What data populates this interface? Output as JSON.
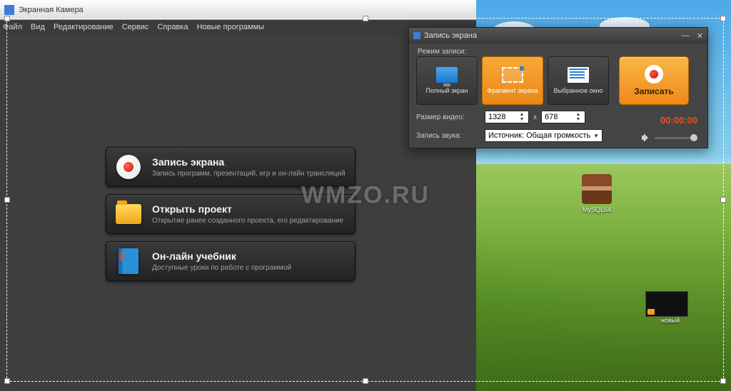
{
  "app": {
    "title": "Экранная Камера",
    "menu": [
      "Файл",
      "Вид",
      "Редактирование",
      "Сервис",
      "Справка",
      "Новые программы"
    ]
  },
  "main_buttons": {
    "record": {
      "title": "Запись экрана",
      "sub": "Запись программ, презентаций, игр и он-лайн трансляций"
    },
    "open": {
      "title": "Открыть проект",
      "sub": "Открытие ранее созданного проекта, его редактирование"
    },
    "tutorial": {
      "title": "Он-лайн учебник",
      "sub": "Доступные уроки по работе с программой"
    }
  },
  "watermark": "WMZO.RU",
  "dialog": {
    "title": "Запись экрана",
    "mode_label": "Режим записи:",
    "modes": {
      "full": "Полный экран",
      "fragment": "Фрагмент экрана",
      "window": "Выбранное окно"
    },
    "record_btn": "Записать",
    "size_label": "Размер видео:",
    "width": "1328",
    "x": "x",
    "height": "678",
    "audio_label": "Запись звука:",
    "audio_source": "Источник: Общая громкость",
    "timer": "00:00:00"
  },
  "desktop": {
    "icon1": "MySQL64",
    "icon2": "новый"
  }
}
